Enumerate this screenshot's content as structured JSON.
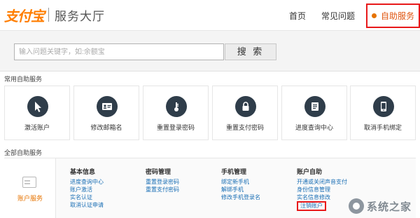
{
  "header": {
    "logo_text": "支付宝",
    "title": "服务大厅",
    "nav": [
      "首页",
      "常见问题",
      "自助服务"
    ]
  },
  "search": {
    "placeholder": "输入问题关键字，如:余额宝",
    "button_label": "搜 索"
  },
  "common": {
    "title": "常用自助服务",
    "cards": [
      {
        "label": "激活账户",
        "icon": "cursor-icon"
      },
      {
        "label": "修改邮箱名",
        "icon": "id-card-icon"
      },
      {
        "label": "重置登录密码",
        "icon": "key-icon"
      },
      {
        "label": "重置支付密码",
        "icon": "lock-icon"
      },
      {
        "label": "进度查询中心",
        "icon": "document-icon"
      },
      {
        "label": "取消手机绑定",
        "icon": "phone-icon"
      }
    ]
  },
  "all": {
    "title": "全部自助服务",
    "account_label": "账户服务",
    "columns": [
      {
        "title": "基本信息",
        "links": [
          "进度查询中心",
          "账户激活",
          "实名认证",
          "取消认证申请"
        ]
      },
      {
        "title": "密码管理",
        "links": [
          "重置登录密码",
          "重置支付密码"
        ]
      },
      {
        "title": "手机管理",
        "links": [
          "绑定新手机",
          "解绑手机",
          "修改手机登录名"
        ]
      },
      {
        "title": "账户自助",
        "links": [
          "开通或关闭声音支付",
          "身份信息管理",
          "实名信息修改",
          "注销账户"
        ]
      }
    ]
  },
  "watermark": {
    "text": "系统之家"
  },
  "colors": {
    "brand": "#ff7e00",
    "icon_bg": "#2f3d4a",
    "link": "#1a6fb5",
    "highlight_border": "#e8191a"
  }
}
